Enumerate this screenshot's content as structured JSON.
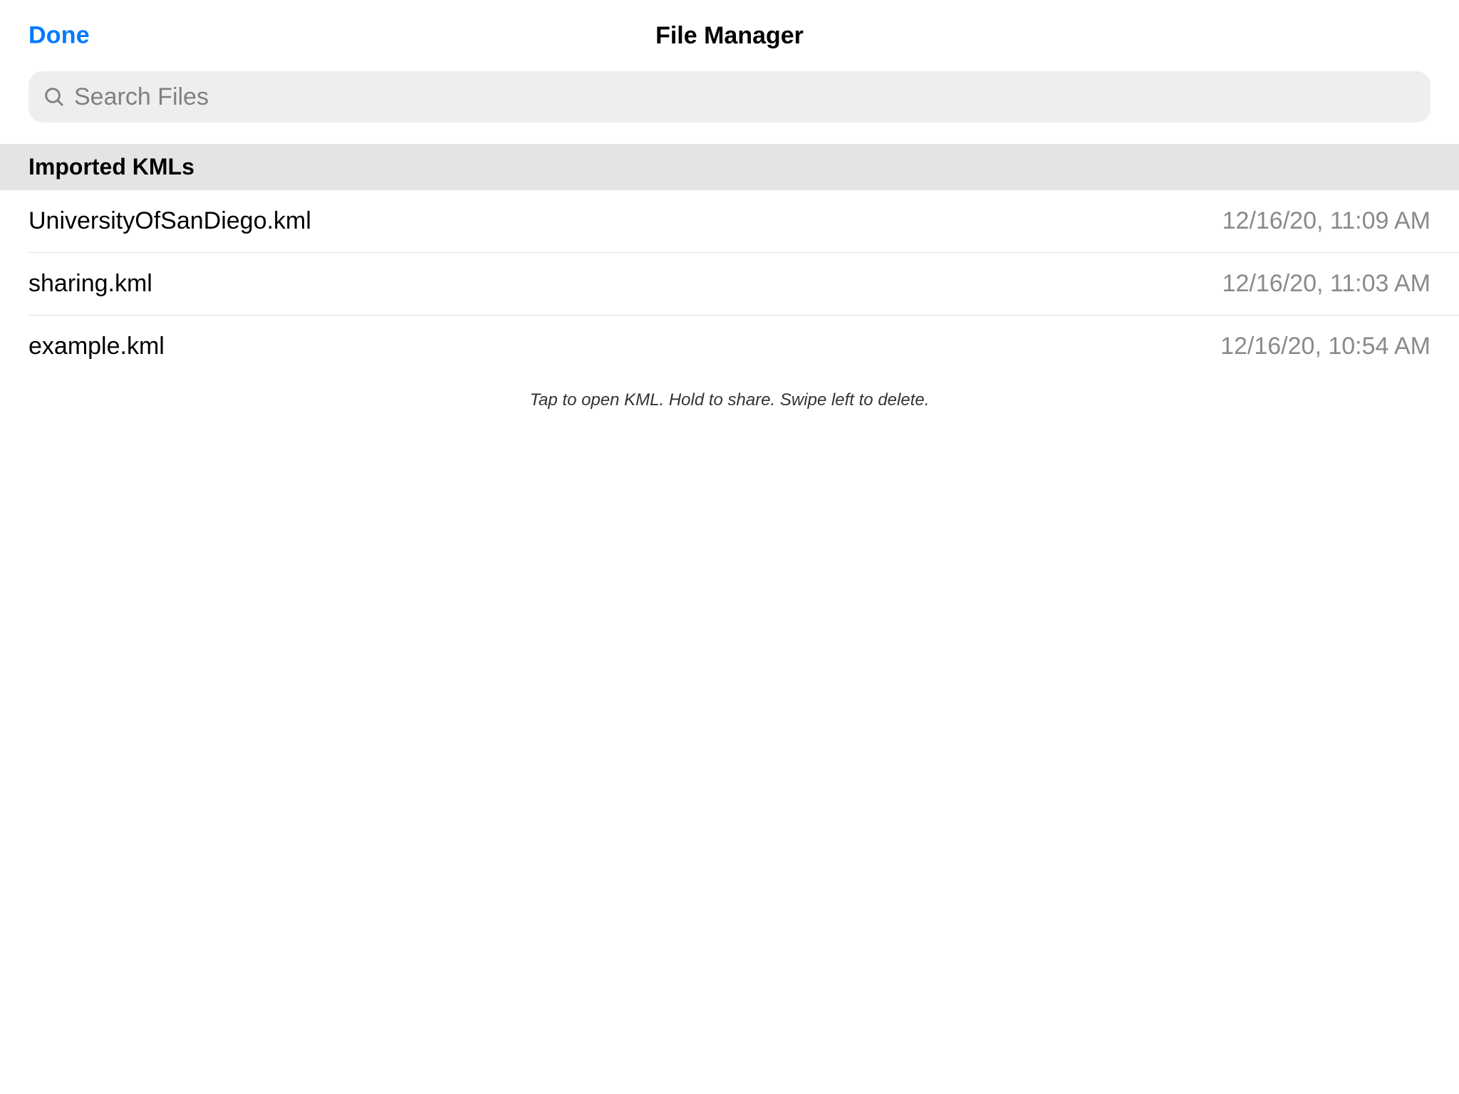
{
  "header": {
    "done_label": "Done",
    "title": "File Manager"
  },
  "search": {
    "placeholder": "Search Files",
    "value": ""
  },
  "section": {
    "title": "Imported KMLs"
  },
  "files": [
    {
      "name": "UniversityOfSanDiego.kml",
      "date": "12/16/20, 11:09 AM"
    },
    {
      "name": "sharing.kml",
      "date": "12/16/20, 11:03 AM"
    },
    {
      "name": "example.kml",
      "date": "12/16/20, 10:54 AM"
    }
  ],
  "hint": "Tap to open KML. Hold to share. Swipe left to delete."
}
